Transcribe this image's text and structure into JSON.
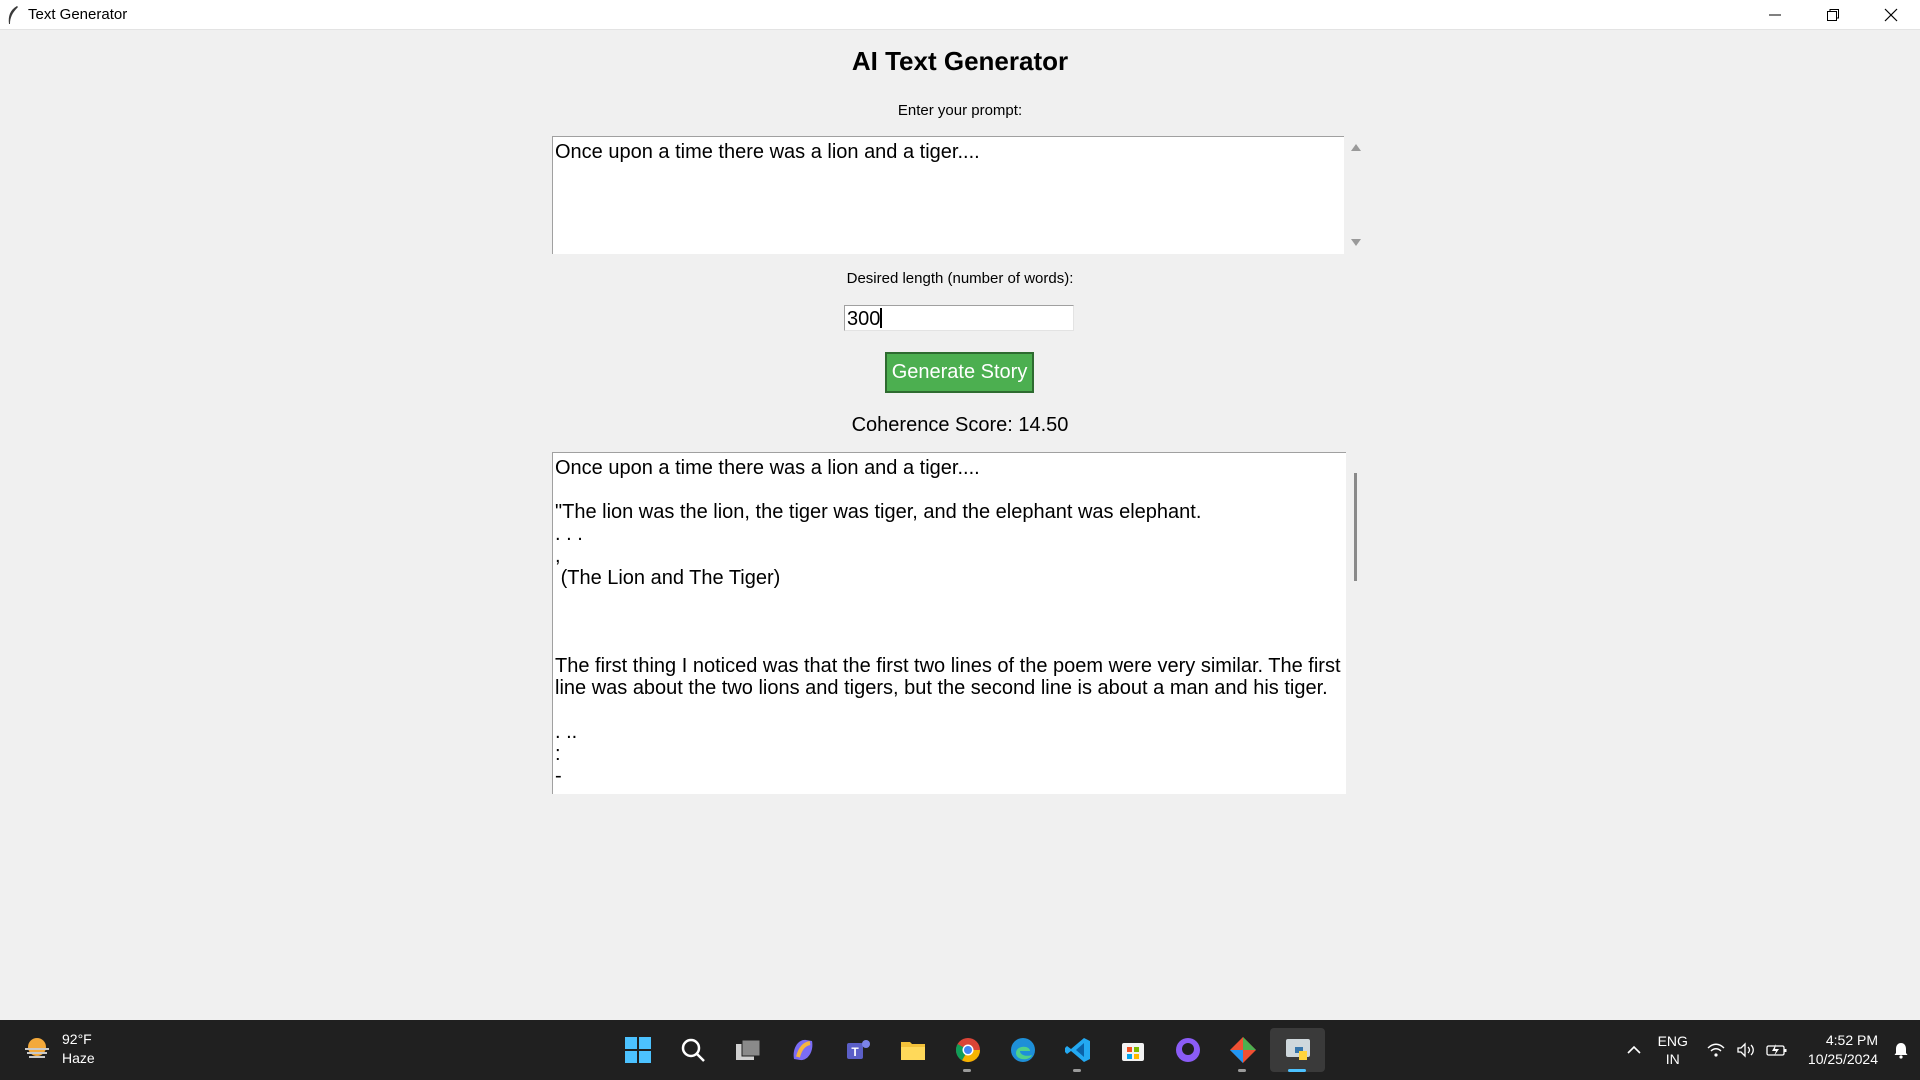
{
  "window": {
    "title": "Text Generator"
  },
  "app": {
    "heading": "AI Text Generator",
    "prompt_label": "Enter your prompt:",
    "prompt_value": "Once upon a time there was a lion and a tiger....",
    "length_label": "Desired length (number of words):",
    "length_value": "300",
    "generate_label": "Generate Story",
    "score_text": "Coherence Score: 14.50",
    "output_text": "Once upon a time there was a lion and a tiger....\n\n\"The lion was the lion, the tiger was tiger, and the elephant was elephant.\n. . .\n,\n (The Lion and The Tiger)\n\n\n\nThe first thing I noticed was that the first two lines of the poem were very similar. The first line was about the two lions and tigers, but the second line is about a man and his tiger.\n\n. ..\n:\n-"
  },
  "taskbar": {
    "weather_temp": "92°F",
    "weather_desc": "Haze",
    "apps": [
      {
        "name": "start-icon"
      },
      {
        "name": "search-icon"
      },
      {
        "name": "task-view-icon"
      },
      {
        "name": "copilot-icon"
      },
      {
        "name": "teams-icon"
      },
      {
        "name": "file-explorer-icon"
      },
      {
        "name": "chrome-icon"
      },
      {
        "name": "edge-icon"
      },
      {
        "name": "vscode-icon"
      },
      {
        "name": "store-icon"
      },
      {
        "name": "github-desktop-icon"
      },
      {
        "name": "git-icon"
      },
      {
        "name": "python-icon"
      }
    ],
    "lang_top": "ENG",
    "lang_bottom": "IN",
    "time": "4:52 PM",
    "date": "10/25/2024"
  },
  "colors": {
    "button_bg": "#4caf50",
    "taskbar_bg": "#202020",
    "window_bg": "#f0f0f0"
  }
}
